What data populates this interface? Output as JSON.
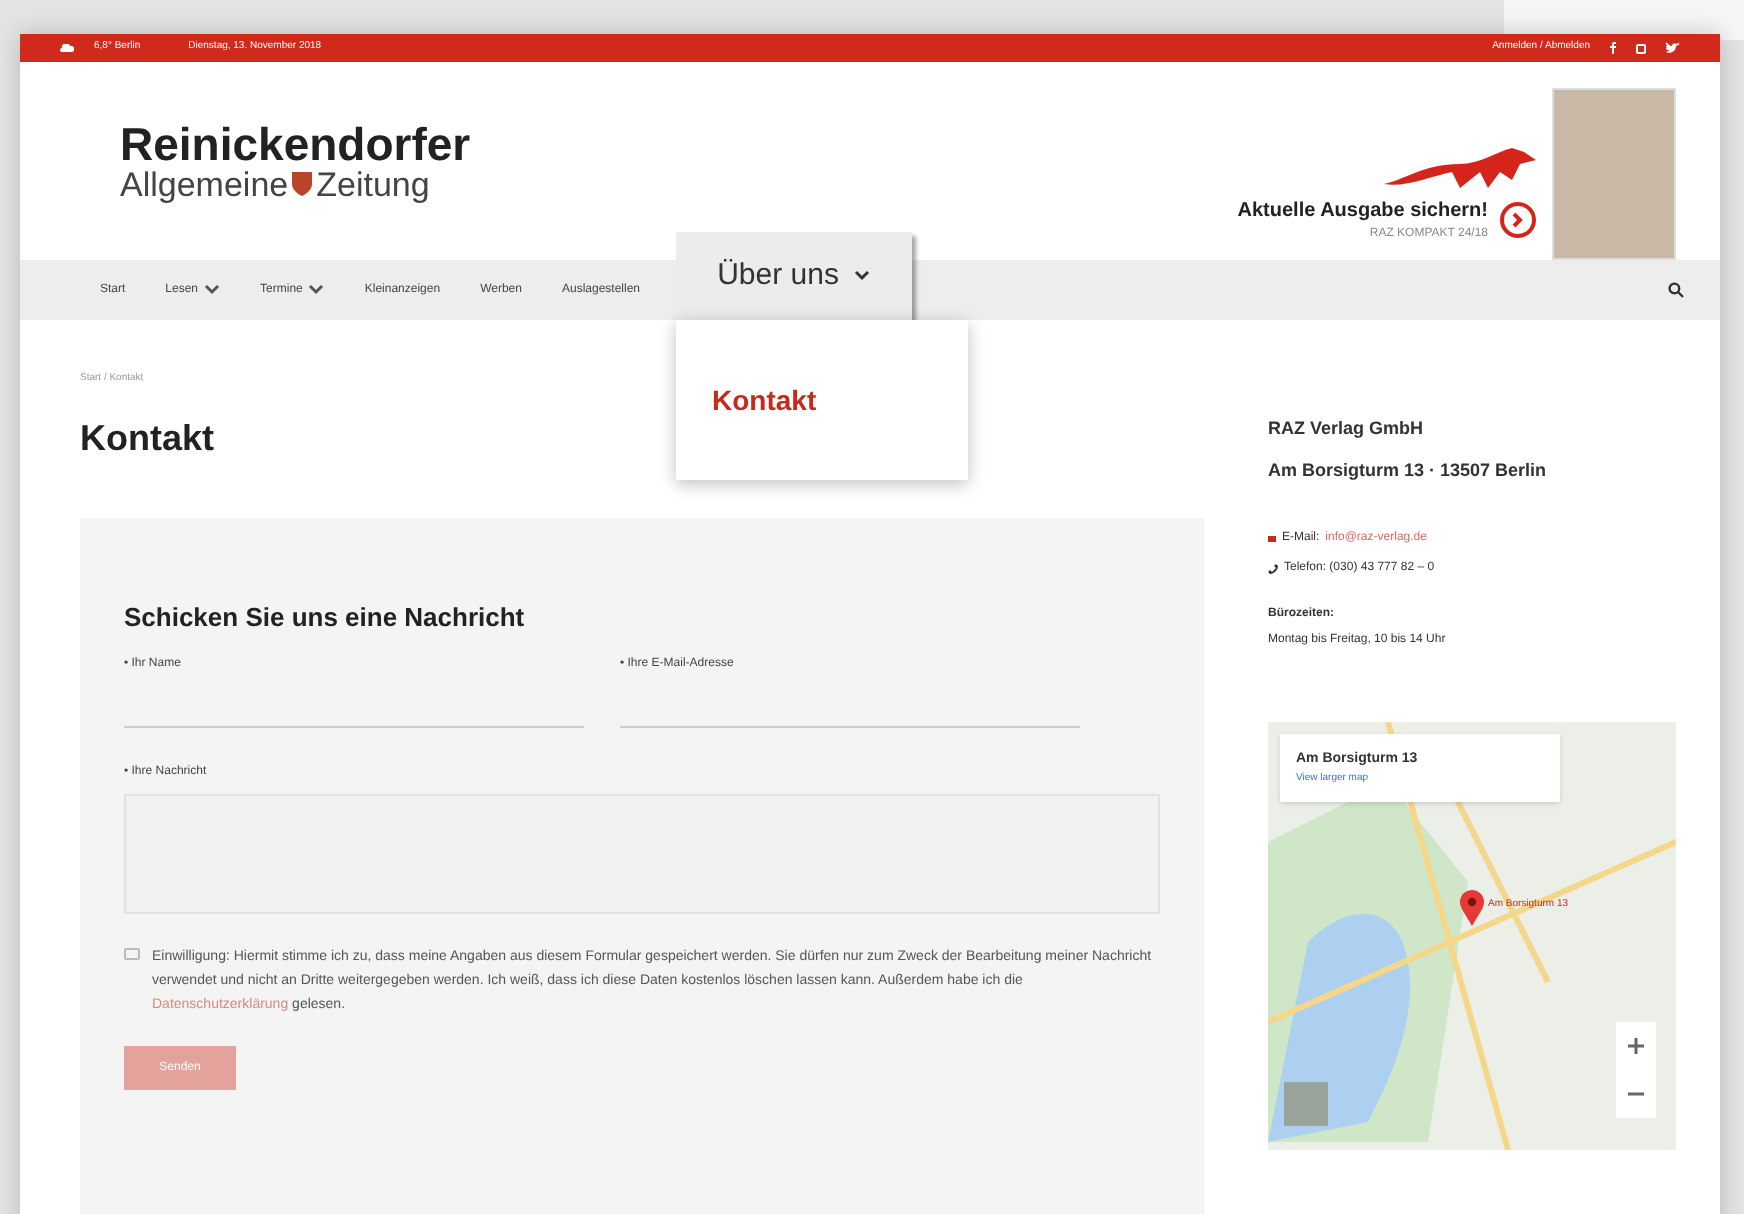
{
  "top_bar": {
    "weather": "6,8°",
    "city": "Berlin",
    "date": "Dienstag, 13. November 2018",
    "account": "Anmelden / Abmelden"
  },
  "logo": {
    "line1": "Reinickendorfer",
    "line2a": "Allgemeine",
    "line2b": "Zeitung"
  },
  "promo": {
    "title": "Aktuelle Ausgabe sichern!",
    "subtitle": "RAZ KOMPAKT 24/18"
  },
  "nav": [
    {
      "label": "Start",
      "has_menu": false,
      "expanded": false
    },
    {
      "label": "Lesen",
      "has_menu": true,
      "expanded": false
    },
    {
      "label": "Termine",
      "has_menu": true,
      "expanded": false
    },
    {
      "label": "Kleinanzeigen",
      "has_menu": false,
      "expanded": false
    },
    {
      "label": "Werben",
      "has_menu": false,
      "expanded": false
    },
    {
      "label": "Auslagestellen",
      "has_menu": false,
      "expanded": false
    },
    {
      "label": "Über uns",
      "has_menu": true,
      "expanded": true,
      "menu": [
        "Kontakt"
      ]
    }
  ],
  "breadcrumb": "Start / Kontakt",
  "page_title": "Kontakt",
  "form": {
    "heading": "Schicken Sie uns eine Nachricht",
    "name_label": "• Ihr Name",
    "email_label": "• Ihre E-Mail-Adresse",
    "message_label": "• Ihre Nachricht",
    "consent_checked": false,
    "consent_text": "Einwilligung: Hiermit stimme ich zu, dass meine Angaben aus diesem Formular gespeichert werden. Sie dürfen nur zum Zweck der Bearbeitung meiner Nachricht verwendet und nicht an Dritte weitergegeben werden. Ich weiß, dass ich diese Daten kostenlos löschen lassen kann. Außerdem habe ich die",
    "consent_link": "Datenschutzerklärung",
    "consent_end": "gelesen.",
    "submit": "Senden",
    "submit_disabled": true
  },
  "contact": {
    "company": "RAZ Verlag GmbH",
    "address": "Am Borsigturm 13 · 13507 Berlin",
    "email_label": "E-Mail:",
    "email": "info@raz-verlag.de",
    "phone": "Telefon: (030) 43 777 82 – 0",
    "hours_label": "Bürozeiten:",
    "hours": "Montag bis Freitag, 10 bis 14 Uhr"
  },
  "map": {
    "place": "Am Borsigturm 13",
    "link": "View larger map",
    "marker_label": "Am Borsigturm 13"
  }
}
